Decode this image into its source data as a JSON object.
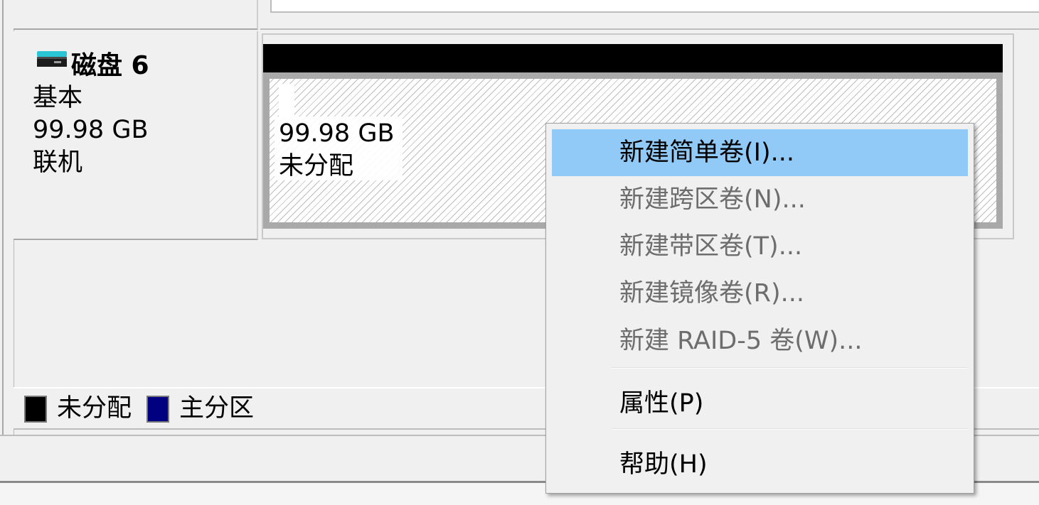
{
  "disk": {
    "title": "磁盘 6",
    "type": "基本",
    "size": "99.98 GB",
    "status": "联机"
  },
  "partition": {
    "size": "99.98 GB",
    "status": "未分配"
  },
  "legend": {
    "items": [
      {
        "label": "未分配",
        "color": "#000000"
      },
      {
        "label": "主分区",
        "color": "#000080"
      }
    ]
  },
  "context_menu": {
    "items": [
      {
        "label": "新建简单卷(I)...",
        "state": "highlighted"
      },
      {
        "label": "新建跨区卷(N)...",
        "state": "disabled"
      },
      {
        "label": "新建带区卷(T)...",
        "state": "disabled"
      },
      {
        "label": "新建镜像卷(R)...",
        "state": "disabled"
      },
      {
        "label": "新建 RAID-5 卷(W)...",
        "state": "disabled"
      },
      {
        "label": "属性(P)",
        "state": "enabled"
      },
      {
        "label": "帮助(H)",
        "state": "enabled"
      }
    ]
  },
  "colors": {
    "highlight": "#91c9f7",
    "disk_icon": "#2ac6d6",
    "unallocated": "#000000",
    "primary_partition": "#000080"
  }
}
